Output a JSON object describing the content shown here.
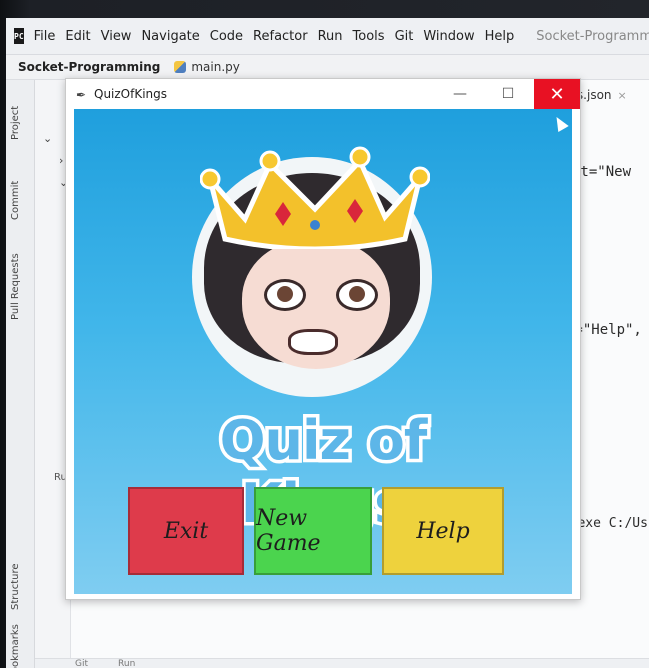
{
  "ide": {
    "menu": [
      "File",
      "Edit",
      "View",
      "Navigate",
      "Code",
      "Refactor",
      "Run",
      "Tools",
      "Git",
      "Window",
      "Help"
    ],
    "title_fragment": "Socket-Programming - m",
    "project_name": "Socket-Programming",
    "open_file": "main.py",
    "side_tabs": [
      "Project",
      "Commit",
      "Pull Requests"
    ],
    "side_tabs_bottom": [
      "Structure",
      "Bookmarks"
    ],
    "run_label": "Run:",
    "right_tab": "rs.json",
    "code_fragments": [
      "xt=\"New",
      "t=\"Help\",",
      "on.exe C:/Us"
    ],
    "bottom_tabs": [
      "Git",
      "Run"
    ]
  },
  "app": {
    "title": "QuizOfKings",
    "logo_text": "Quiz of Kings",
    "buttons": {
      "exit": "Exit",
      "new_game": "New Game",
      "help": "Help"
    },
    "colors": {
      "exit": "#de3b4b",
      "new_game": "#4bd44e",
      "help": "#eed23d",
      "close": "#e81123",
      "background": "#1f9fdd"
    }
  }
}
